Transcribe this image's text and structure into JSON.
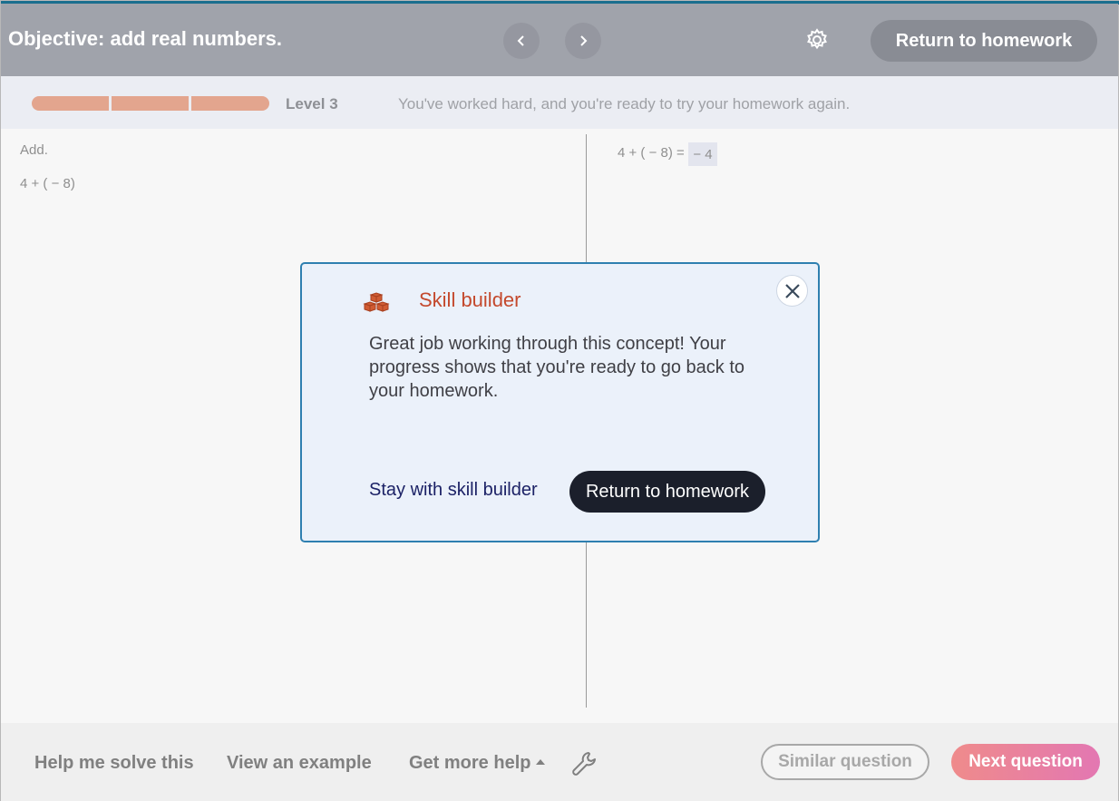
{
  "header": {
    "objective": "Objective: add real numbers.",
    "prev_icon": "chevron-left-icon",
    "next_icon": "chevron-right-icon",
    "settings_icon": "gear-icon",
    "return_label": "Return to homework"
  },
  "level": {
    "segments_filled": 3,
    "segments_total": 3,
    "label": "Level 3",
    "message": "You've worked hard, and you're ready to try your homework again.",
    "bar_color": "#e3a58e"
  },
  "question": {
    "instruction": "Add.",
    "problem": "4 + ( − 8)"
  },
  "work": {
    "equation": "4 + ( − 8) =",
    "answer": "− 4"
  },
  "modal": {
    "icon": "blocks-icon",
    "title": "Skill builder",
    "body": "Great job working through this concept! Your progress shows that you're ready to go back to your homework.",
    "stay_label": "Stay with skill builder",
    "return_label": "Return to homework",
    "close_icon": "close-icon"
  },
  "footer": {
    "help_solve": "Help me solve this",
    "view_example": "View an example",
    "more_help": "Get more help",
    "tools_icon": "wrench-icon",
    "similar": "Similar question",
    "next": "Next question"
  },
  "colors": {
    "header_bg": "#a0a3ab",
    "accent_title": "#c4492d",
    "modal_border": "#2e7fb0",
    "next_gradient_start": "#ef8b8b",
    "next_gradient_end": "#e377b2"
  }
}
